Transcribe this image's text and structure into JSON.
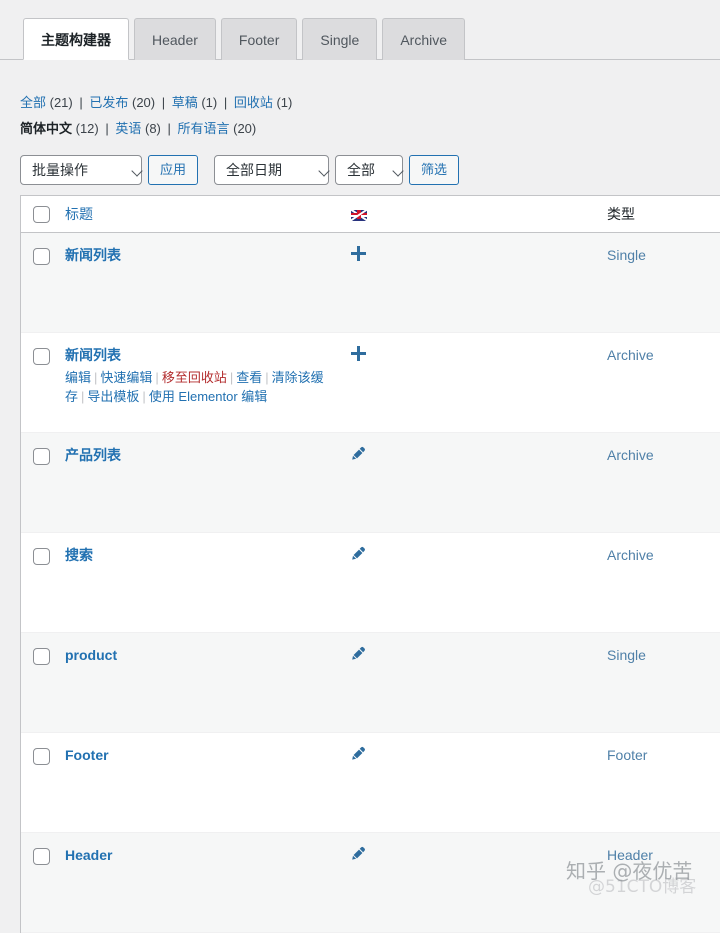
{
  "tabs": [
    {
      "label": "主题构建器",
      "active": true
    },
    {
      "label": "Header",
      "active": false
    },
    {
      "label": "Footer",
      "active": false
    },
    {
      "label": "Single",
      "active": false
    },
    {
      "label": "Archive",
      "active": false
    }
  ],
  "views": {
    "status": [
      {
        "label": "全部",
        "count": "(21)",
        "current": false
      },
      {
        "label": "已发布",
        "count": "(20)",
        "current": false
      },
      {
        "label": "草稿",
        "count": "(1)",
        "current": false
      },
      {
        "label": "回收站",
        "count": "(1)",
        "current": false
      }
    ],
    "languages": [
      {
        "label": "简体中文",
        "count": "(12)",
        "current": true
      },
      {
        "label": "英语",
        "count": "(8)",
        "current": false
      },
      {
        "label": "所有语言",
        "count": "(20)",
        "current": false
      }
    ],
    "separator": "|"
  },
  "tablenav": {
    "bulk_action_value": "批量操作",
    "apply_label": "应用",
    "date_value": "全部日期",
    "lang_value": "全部",
    "filter_label": "筛选"
  },
  "table": {
    "columns": {
      "title": "标题",
      "flag": "uk-flag-icon",
      "type": "类型"
    },
    "rows": [
      {
        "title": "新闻列表",
        "icon": "plus-icon",
        "type": "Single",
        "actions": []
      },
      {
        "title": "新闻列表",
        "icon": "plus-icon",
        "type": "Archive",
        "actions": [
          {
            "label": "编辑",
            "kind": "link"
          },
          {
            "label": "快速编辑",
            "kind": "link"
          },
          {
            "label": "移至回收站",
            "kind": "trash"
          },
          {
            "label": "查看",
            "kind": "link"
          },
          {
            "label": "清除该缓存",
            "kind": "link"
          },
          {
            "label": "导出模板",
            "kind": "link"
          },
          {
            "label": "使用 Elementor 编辑",
            "kind": "link"
          }
        ]
      },
      {
        "title": "产品列表",
        "icon": "pencil-icon",
        "type": "Archive",
        "actions": []
      },
      {
        "title": "搜索",
        "icon": "pencil-icon",
        "type": "Archive",
        "actions": []
      },
      {
        "title": "product",
        "icon": "pencil-icon",
        "type": "Single",
        "actions": []
      },
      {
        "title": "Footer",
        "icon": "pencil-icon",
        "type": "Footer",
        "actions": []
      },
      {
        "title": "Header",
        "icon": "pencil-icon",
        "type": "Header",
        "actions": []
      }
    ]
  },
  "watermarks": {
    "zhihu": "知乎 @夜优苦",
    "cto": "@51CTO博客"
  },
  "colors": {
    "link": "#2271b1",
    "trash": "#b32d2e",
    "page_bg": "#f0f0f1",
    "row_alt": "#f6f7f7",
    "border": "#c3c4c7"
  }
}
